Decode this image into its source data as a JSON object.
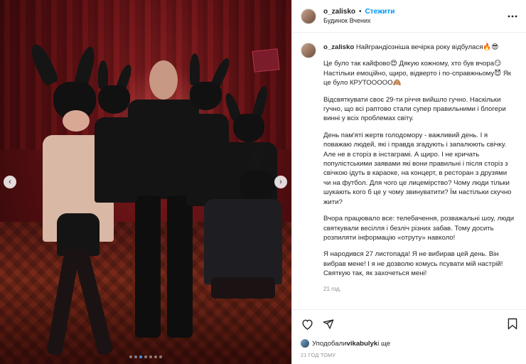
{
  "post": {
    "username": "o_zalisko",
    "follow_label": "Стежити",
    "separator": "•",
    "location": "Будинок Вчених",
    "more_icon": "more-horizontal-icon"
  },
  "photo": {
    "prev_icon": "chevron-left-icon",
    "next_icon": "chevron-right-icon",
    "prev_glyph": "‹",
    "next_glyph": "›",
    "slide_count": 7,
    "active_slide": 3
  },
  "caption": {
    "username": "o_zalisko",
    "first_line": " Найграндіозніша вечірка року відбулася🔥😎",
    "p1": "Це було так кайфово😍 Дякую кожному, хто був вчора😏 Настільки емоційно, щиро, відверто і по-справжньому😈 Як це було КРУТООООО🙈",
    "p2": "Відсвяткувати своє 29-ти річчя вийшло гучно. Наскільки гучно, що всі раптово стали супер правильними і блогери винні у всіх проблемах світу.",
    "p3": "День пам'яті жертв голодомору - важливий день. І я поважаю людей, які і правда згадують і запалюють свічку. Але не в сторіз в інстаграмі. А щиро. І не кричать популістськими заявами які вони правильні і після сторіз з свічкою ідуть в караоке, на концерт, в ресторан з друзями чи на футбол. Для чого це лицемірство? Чому люди тільки шукають кого б це у чому звинуватити? Їм настільки скучно жити?",
    "p4": "Вчора працювало все: телебачення, розважальні шоу, люди святкували весілля і безліч різних забав. Тому досить розпиляти інформацію «отруту» навколо!",
    "p5": "Я народився 27 листопада! Я не вибирав цей день. Він вибрав мене! І я не дозволю комусь псувати мій настрій! Святкую так, як захочеться мені!",
    "time": "21 год."
  },
  "actions": {
    "like_icon": "heart-icon",
    "share_icon": "send-icon",
    "save_icon": "bookmark-icon"
  },
  "likes": {
    "prefix": "Уподобали ",
    "user": "vikabulyk",
    "suffix": " і ще"
  },
  "posted_ago": "21 ГОД ТОМУ",
  "colors": {
    "accent": "#0095f6",
    "active_dot": "#3897f0",
    "muted": "#8e8e8e"
  }
}
